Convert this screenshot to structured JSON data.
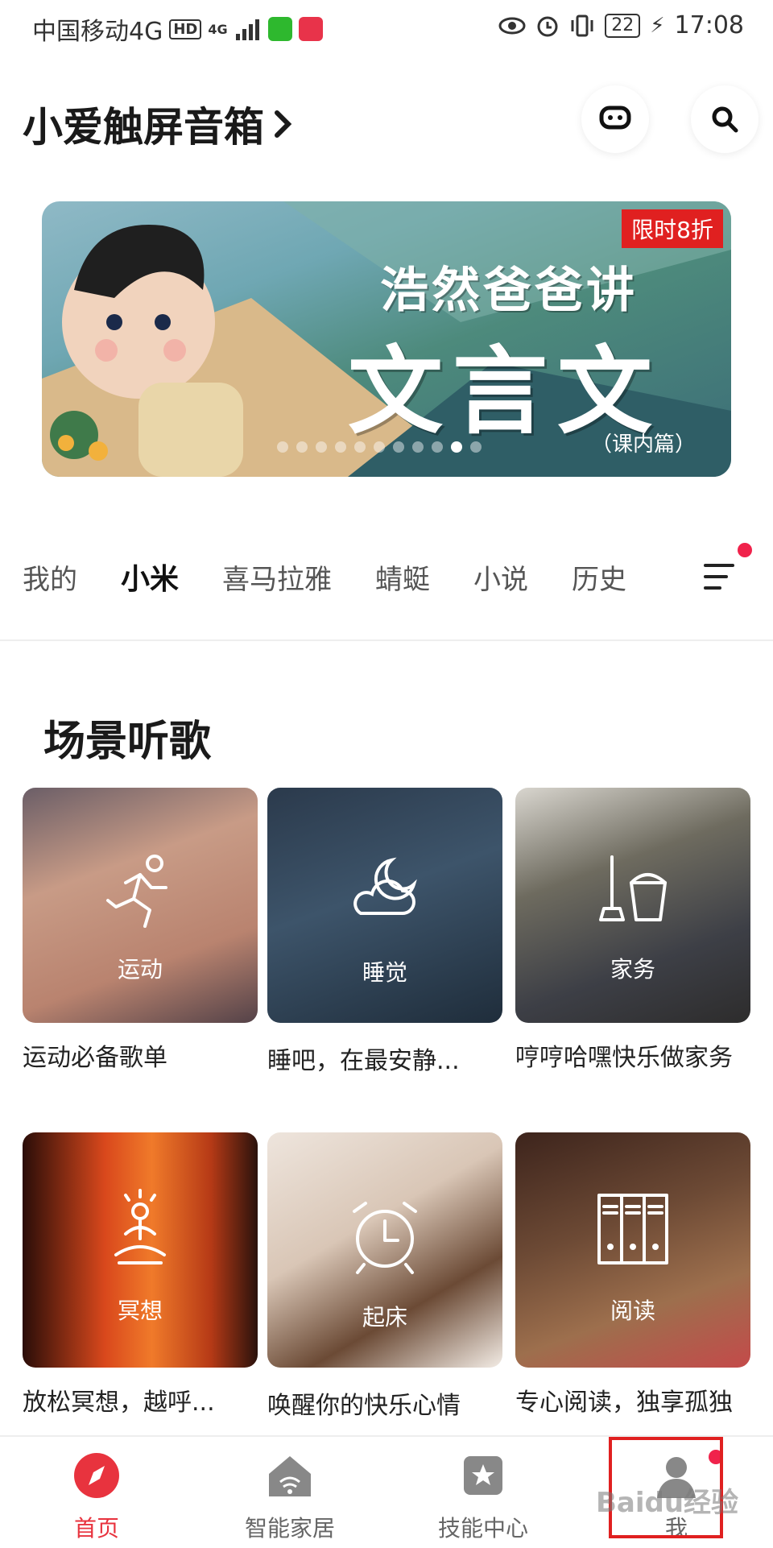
{
  "status_bar": {
    "carrier": "中国移动4G",
    "hd": "HD",
    "signal": "4G",
    "battery": "22",
    "time": "17:08"
  },
  "header": {
    "device_name": "小爱触屏音箱",
    "chevron": "›"
  },
  "banner": {
    "tag": "限时8折",
    "title_line1": "浩然爸爸讲",
    "title_line2": "文言文",
    "subtitle": "（课内篇）",
    "dot_count": 11,
    "active_dot": 10
  },
  "tabs": [
    {
      "label": "我的"
    },
    {
      "label": "小米"
    },
    {
      "label": "喜马拉雅"
    },
    {
      "label": "蜻蜓"
    },
    {
      "label": "小说"
    },
    {
      "label": "历史"
    }
  ],
  "active_tab": "小米",
  "section": {
    "title": "场景听歌",
    "cards": [
      {
        "label": "运动",
        "caption": "运动必备歌单",
        "icon": "running-icon"
      },
      {
        "label": "睡觉",
        "caption": "睡吧，在最安静...",
        "icon": "moon-cloud-icon"
      },
      {
        "label": "家务",
        "caption": "哼哼哈嘿快乐做家务",
        "icon": "mop-bucket-icon"
      },
      {
        "label": "冥想",
        "caption": "放松冥想，越呼...",
        "icon": "meditation-icon"
      },
      {
        "label": "起床",
        "caption": "唤醒你的快乐心情",
        "icon": "alarm-clock-icon"
      },
      {
        "label": "阅读",
        "caption": "专心阅读，独享孤独",
        "icon": "bookshelf-icon"
      }
    ]
  },
  "bottom_nav": [
    {
      "label": "首页",
      "icon": "compass-icon"
    },
    {
      "label": "智能家居",
      "icon": "smart-home-icon"
    },
    {
      "label": "技能中心",
      "icon": "star-box-icon"
    },
    {
      "label": "我",
      "icon": "profile-icon"
    }
  ],
  "watermark": "Baidu经验"
}
